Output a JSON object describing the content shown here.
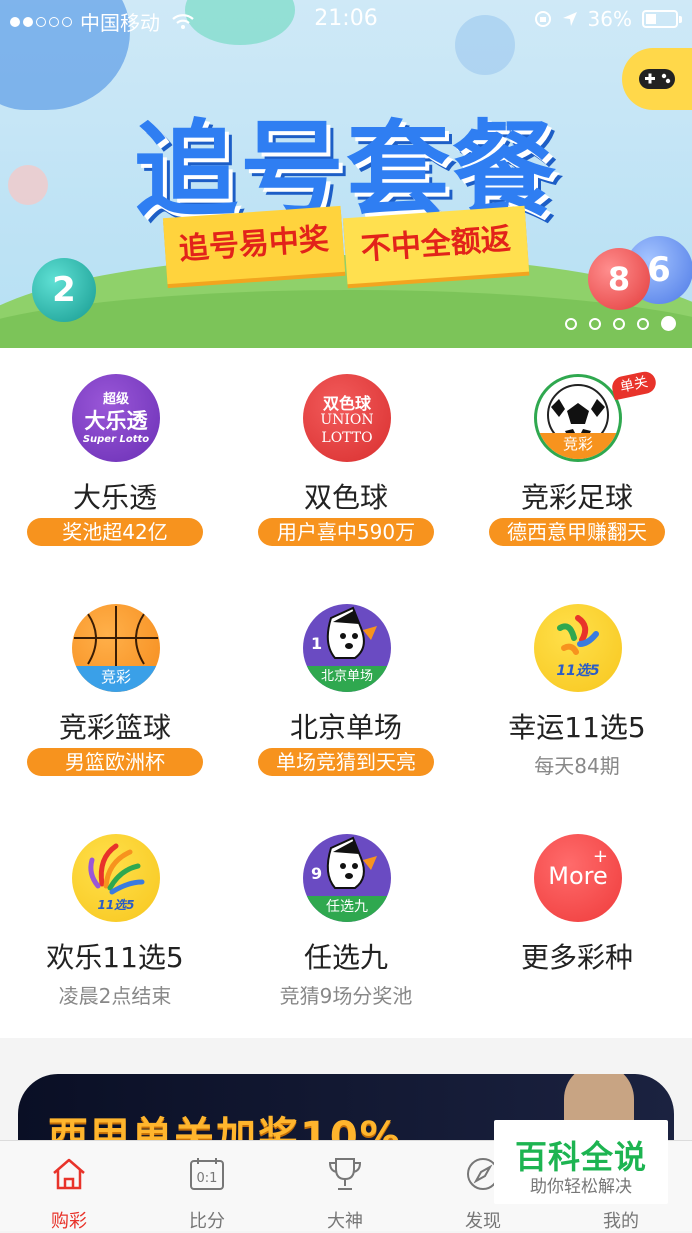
{
  "status_bar": {
    "carrier": "中国移动",
    "time": "21:06",
    "battery": "36%"
  },
  "banner": {
    "title": "追号套餐",
    "ribbon_left": "追号易中奖",
    "ribbon_right": "不中全额返",
    "ball_numbers": [
      "2",
      "8",
      "6"
    ],
    "slide_count": 5,
    "active_slide": 5
  },
  "games": [
    {
      "name": "大乐透",
      "tag": "奖池超42亿",
      "icon": "dlt-icon",
      "icon_top": "超级",
      "icon_mid": "大乐透",
      "icon_bot": "Super Lotto"
    },
    {
      "name": "双色球",
      "tag": "用户喜中590万",
      "icon": "ssq-icon",
      "icon_top": "双色球",
      "icon_mid": "UNION",
      "icon_bot": "LOTTO"
    },
    {
      "name": "竞彩足球",
      "tag": "德西意甲赚翻天",
      "icon": "football-icon",
      "icon_band": "竞彩",
      "corner": "单关"
    },
    {
      "name": "竞彩篮球",
      "tag": "男篮欧洲杯",
      "icon": "basketball-icon",
      "icon_band": "竞彩"
    },
    {
      "name": "北京单场",
      "tag": "单场竞猜到天亮",
      "icon": "bjdc-icon",
      "icon_band": "北京单场",
      "icon_num": "1"
    },
    {
      "name": "幸运11选5",
      "sub": "每天84期",
      "icon": "lucky-11x5-icon",
      "icon_band": "11选5"
    },
    {
      "name": "欢乐11选5",
      "sub": "凌晨2点结束",
      "icon": "happy-11x5-icon",
      "icon_band": "11选5"
    },
    {
      "name": "任选九",
      "sub": "竞猜9场分奖池",
      "icon": "rx9-icon",
      "icon_band": "任选九",
      "icon_num": "9"
    },
    {
      "name": "更多彩种",
      "icon": "more-icon",
      "icon_mid": "More"
    }
  ],
  "ad_banner": {
    "text": "西甲单关加奖10%"
  },
  "tabs": [
    {
      "label": "购彩",
      "icon": "home-icon",
      "active": true
    },
    {
      "label": "比分",
      "icon": "score-icon",
      "icon_text": "0:1"
    },
    {
      "label": "大神",
      "icon": "trophy-icon"
    },
    {
      "label": "发现",
      "icon": "compass-icon"
    },
    {
      "label": "我的",
      "icon": "user-icon"
    }
  ],
  "watermark": {
    "title": "百科全说",
    "subtitle": "助你轻松解决"
  },
  "colors": {
    "accent": "#e8332a",
    "tag_orange": "#f7931e",
    "banner_blue": "#2f7ef2"
  }
}
